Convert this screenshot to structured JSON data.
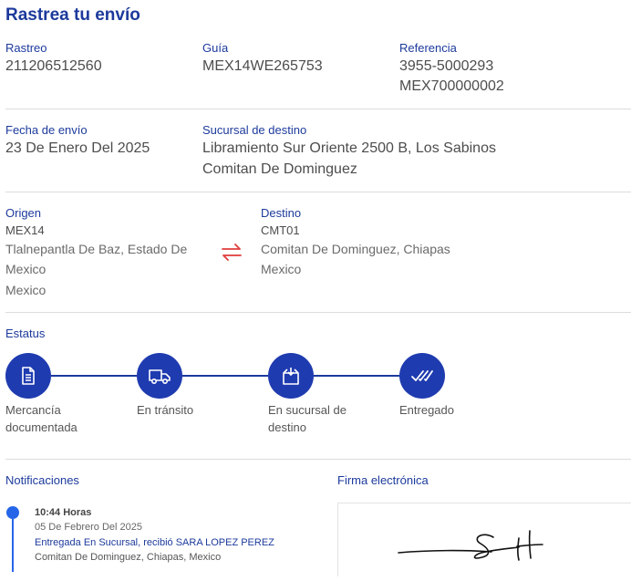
{
  "page": {
    "title": "Rastrea tu envío"
  },
  "info": {
    "rastreo": {
      "label": "Rastreo",
      "value": "211206512560"
    },
    "guia": {
      "label": "Guía",
      "value": "MEX14WE265753"
    },
    "referencia": {
      "label": "Referencia",
      "value1": "3955-5000293",
      "value2": "MEX700000002"
    },
    "fecha": {
      "label": "Fecha de envío",
      "value": "23 De Enero Del 2025"
    },
    "sucursal": {
      "label": "Sucursal de destino",
      "line1": "Libramiento Sur Oriente 2500 B, Los Sabinos",
      "line2": "Comitan De Dominguez"
    }
  },
  "route": {
    "origen": {
      "label": "Origen",
      "code": "MEX14",
      "line1": "Tlalnepantla De Baz, Estado De",
      "line2": "Mexico",
      "line3": "Mexico"
    },
    "destino": {
      "label": "Destino",
      "code": "CMT01",
      "line1": "Comitan De Dominguez, Chiapas",
      "line2": "Mexico"
    },
    "swap_icon": "swap-arrows-icon",
    "swap_color": "#e03c3c"
  },
  "status": {
    "label": "Estatus",
    "steps": [
      {
        "line1": "Mercancía",
        "line2": "documentada",
        "icon": "document-icon"
      },
      {
        "line1": "En tránsito",
        "line2": "",
        "icon": "truck-icon"
      },
      {
        "line1": "En sucursal de",
        "line2": "destino",
        "icon": "package-icon"
      },
      {
        "line1": "Entregado",
        "line2": "",
        "icon": "double-check-icon"
      }
    ]
  },
  "notifications": {
    "label": "Notificaciones",
    "items": [
      {
        "time": "10:44 Horas",
        "date": "05 De Febrero Del 2025",
        "event": "Entregada En Sucursal, recibió SARA LOPEZ PEREZ",
        "place": "Comitan De Dominguez, Chiapas, Mexico"
      }
    ]
  },
  "signature": {
    "label": "Firma electrónica"
  },
  "colors": {
    "brand": "#1c3a9c",
    "step": "#1f3bb0",
    "timeline": "#2566e8"
  }
}
